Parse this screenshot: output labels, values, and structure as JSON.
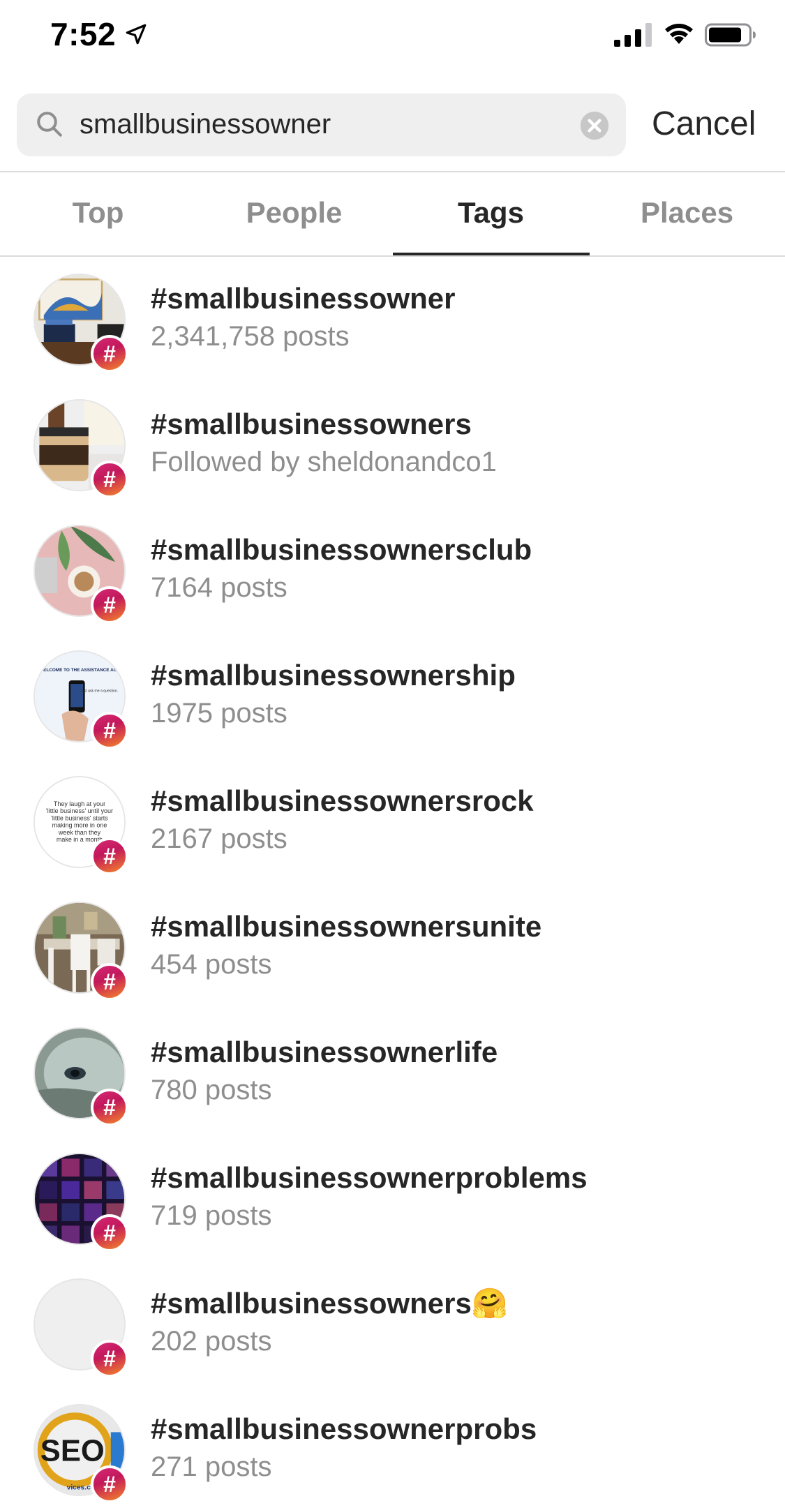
{
  "status_bar": {
    "time": "7:52"
  },
  "search": {
    "value": "smallbusinessowner",
    "cancel_label": "Cancel"
  },
  "tabs": [
    {
      "label": "Top",
      "active": false
    },
    {
      "label": "People",
      "active": false
    },
    {
      "label": "Tags",
      "active": true
    },
    {
      "label": "Places",
      "active": false
    }
  ],
  "hash_symbol": "#",
  "results": [
    {
      "name": "#smallbusinessowner",
      "subtitle": "2,341,758 posts",
      "thumb": "interior-photo"
    },
    {
      "name": "#smallbusinessowners",
      "subtitle": "Followed by sheldonandco1",
      "thumb": "jar-photo"
    },
    {
      "name": "#smallbusinessownersclub",
      "subtitle": "7164 posts",
      "thumb": "coffee-photo"
    },
    {
      "name": "#smallbusinessownership",
      "subtitle": "1975 posts",
      "thumb": "phone-photo"
    },
    {
      "name": "#smallbusinessownersrock",
      "subtitle": "2167 posts",
      "thumb": "quote-image"
    },
    {
      "name": "#smallbusinessownersunite",
      "subtitle": "454 posts",
      "thumb": "chairs-photo"
    },
    {
      "name": "#smallbusinessownerlife",
      "subtitle": "780 posts",
      "thumb": "animal-photo"
    },
    {
      "name": "#smallbusinessownerproblems",
      "subtitle": "719 posts",
      "thumb": "grid-photo"
    },
    {
      "name": "#smallbusinessowners",
      "name_emoji": "🤗",
      "subtitle": "202 posts",
      "thumb": "empty"
    },
    {
      "name": "#smallbusinessownerprobs",
      "subtitle": "271 posts",
      "thumb": "seo-image"
    }
  ],
  "thumb_texts": {
    "phone_header": "WELCOME TO THE ASSISTANCE AGE",
    "phone_caption": "Just ask me a question.",
    "quote": [
      "They laugh at your",
      "'little business' until your",
      "'little business' starts",
      "making more in one",
      "week than they",
      "make in a month"
    ],
    "seo": "SEO",
    "seo_url": "vices.com"
  }
}
